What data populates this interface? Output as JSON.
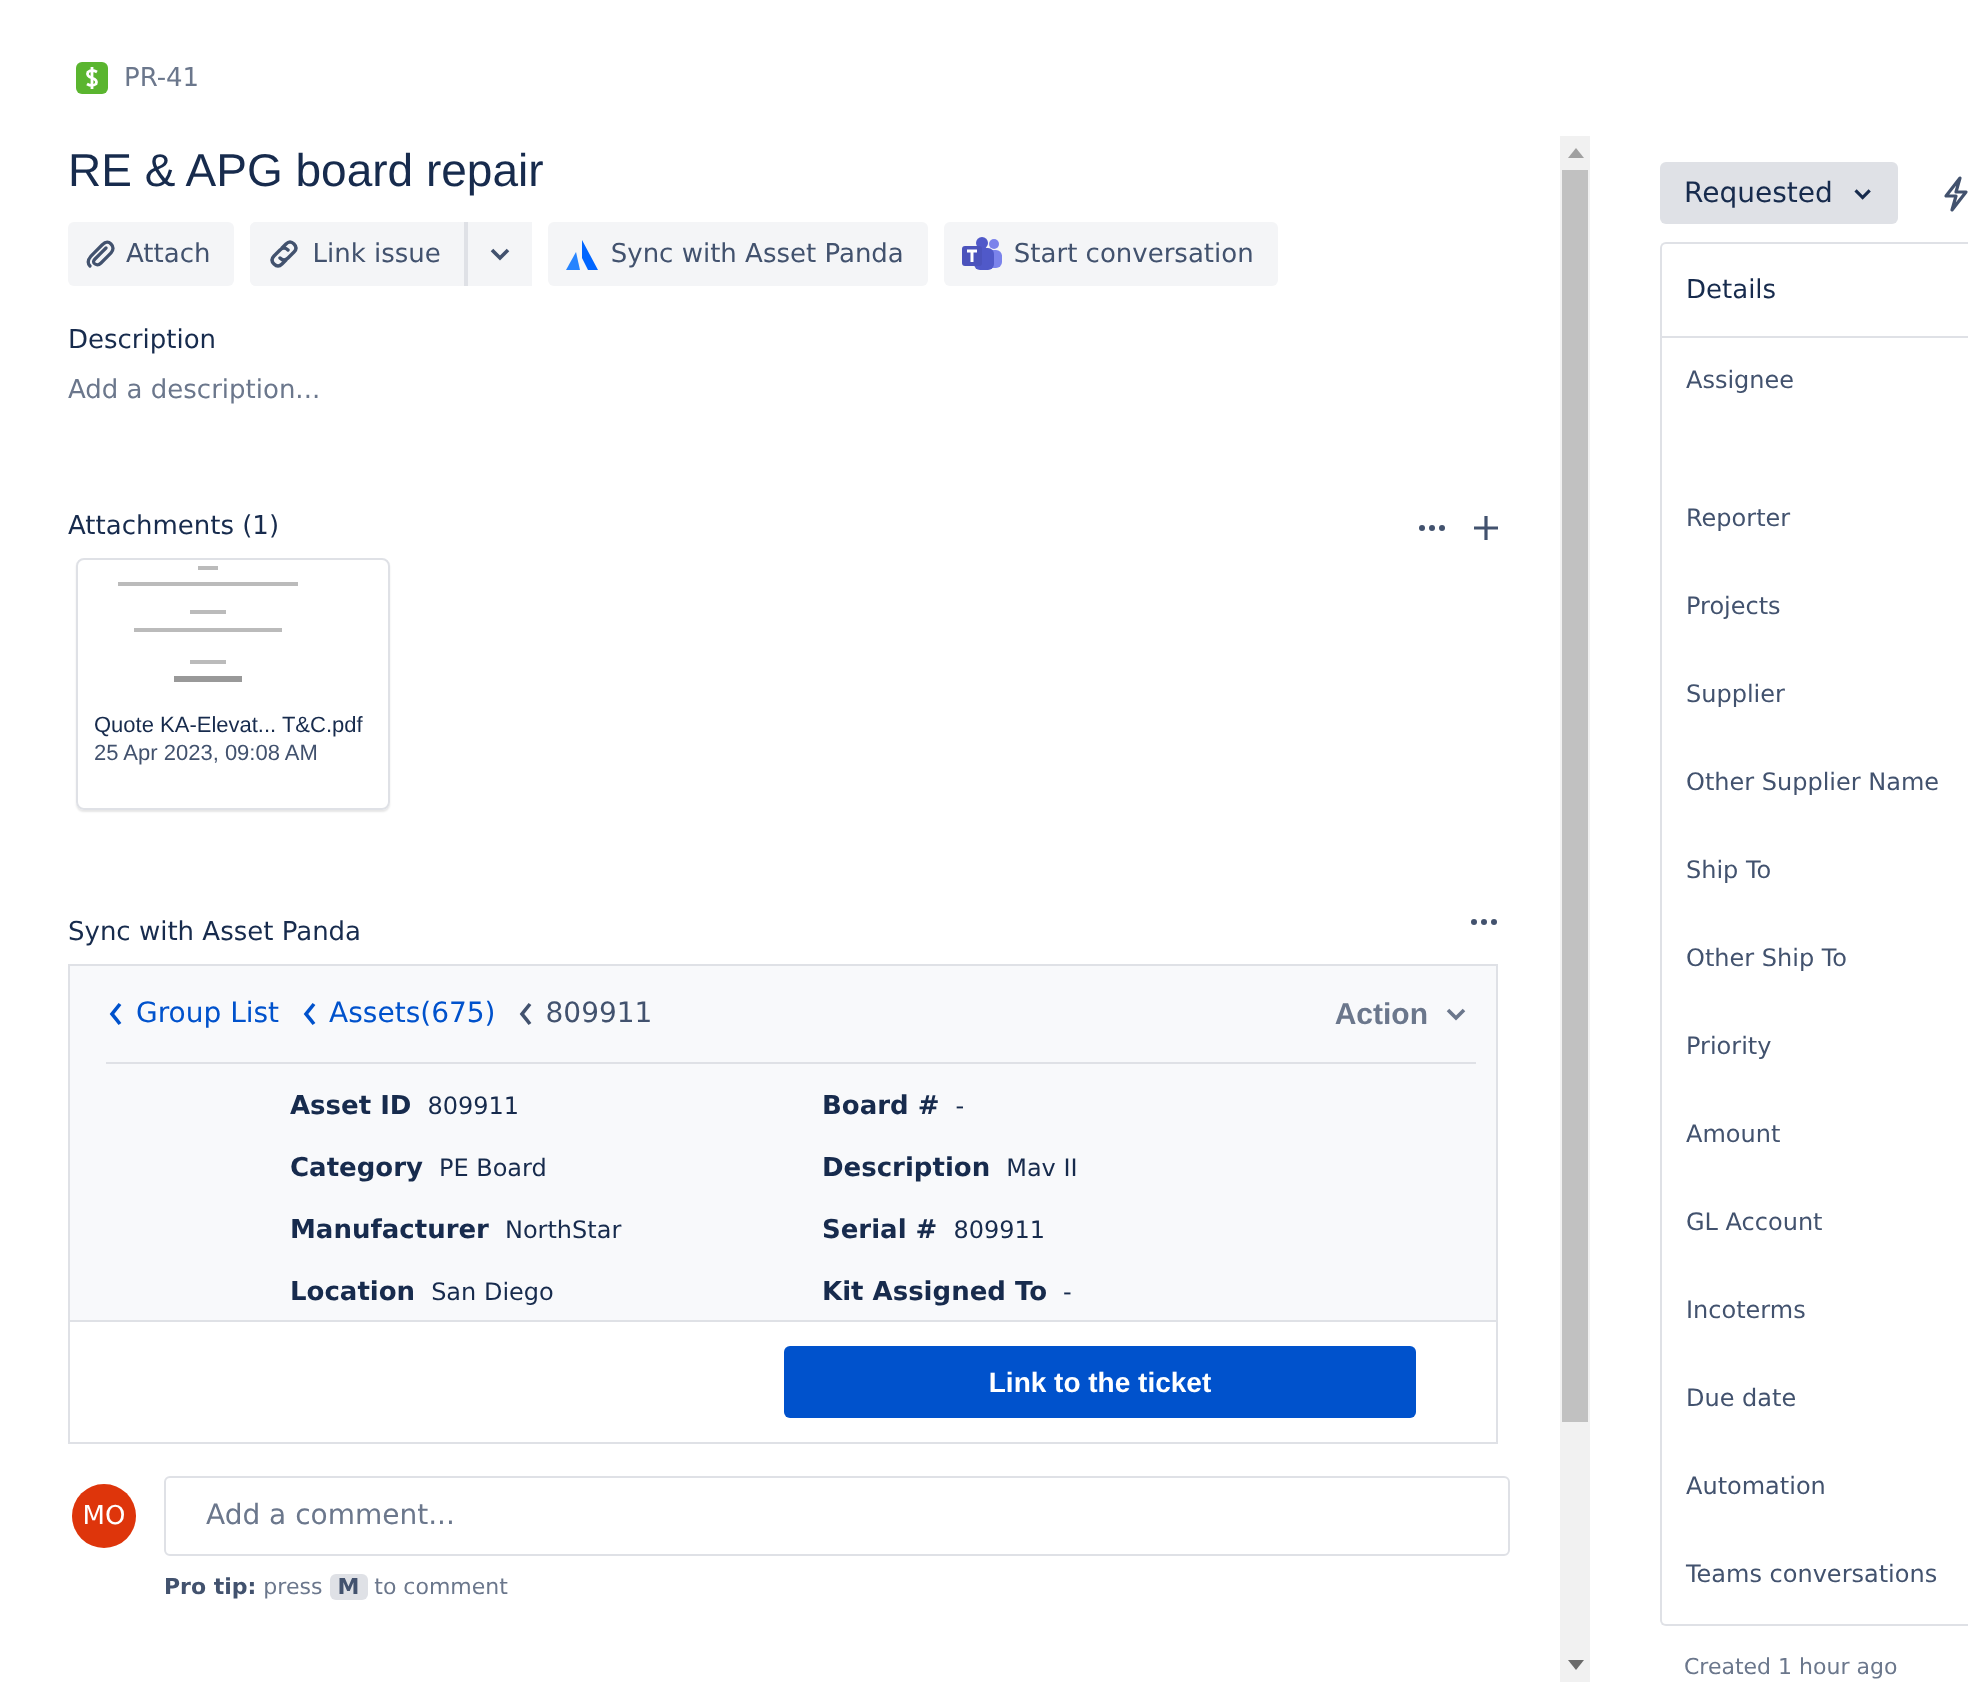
{
  "issue_key": "PR-41",
  "title": "RE & APG board repair",
  "toolbar": [
    {
      "kind": "attach",
      "label": "Attach"
    },
    {
      "kind": "link",
      "label": "Link issue"
    },
    {
      "kind": "sync",
      "label": "Sync with Asset Panda"
    },
    {
      "kind": "teams",
      "label": "Start conversation"
    }
  ],
  "description": {
    "heading": "Description",
    "placeholder": "Add a description..."
  },
  "attachments": {
    "heading": "Attachments (1)",
    "files": [
      {
        "name": "Quote KA-Elevat... T&C.pdf",
        "date": "25 Apr 2023, 09:08 AM"
      }
    ]
  },
  "sync_panel": {
    "heading": "Sync with Asset Panda",
    "breadcrumbs": [
      {
        "label": "Group List",
        "link": true
      },
      {
        "label": "Assets(675)",
        "link": true
      },
      {
        "label": "809911",
        "link": false
      }
    ],
    "action": "Action",
    "field_rows": [
      [
        {
          "label": "Asset ID",
          "value": "809911"
        },
        {
          "label": "Board #",
          "value": "-"
        }
      ],
      [
        {
          "label": "Category",
          "value": "PE Board"
        },
        {
          "label": "Description",
          "value": "Mav II"
        }
      ],
      [
        {
          "label": "Manufacturer",
          "value": "NorthStar"
        },
        {
          "label": "Serial #",
          "value": "809911"
        }
      ],
      [
        {
          "label": "Location",
          "value": "San Diego"
        },
        {
          "label": "Kit Assigned To",
          "value": "-"
        }
      ]
    ],
    "button": "Link to the ticket"
  },
  "comment": {
    "avatar": "MO",
    "placeholder": "Add a comment...",
    "tip_label": "Pro tip:",
    "tip_before": "press",
    "tip_key": "M",
    "tip_after": "to comment"
  },
  "status": "Requested",
  "details": {
    "heading": "Details",
    "fields": [
      "Assignee",
      "Reporter",
      "Projects",
      "Supplier",
      "Other Supplier Name",
      "Ship To",
      "Other Ship To",
      "Priority",
      "Amount",
      "GL Account",
      "Incoterms",
      "Due date",
      "Automation",
      "Teams conversations"
    ]
  },
  "created": "Created 1 hour ago"
}
